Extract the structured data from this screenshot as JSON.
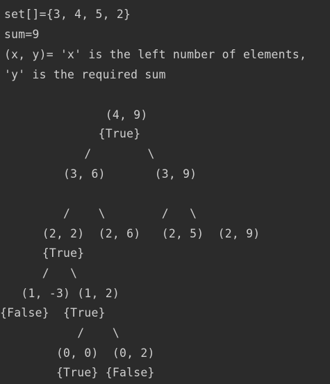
{
  "lines": [
    "set[]={3, 4, 5, 2}",
    "sum=9",
    "(x, y)= 'x' is the left number of elements,",
    "'y' is the required sum",
    "",
    "               (4, 9)",
    "              {True}",
    "            /        \\",
    "         (3, 6)       (3, 9)",
    "",
    "         /    \\        /   \\",
    "      (2, 2)  (2, 6)   (2, 5)  (2, 9)",
    "      {True}",
    "      /   \\",
    "   (1, -3) (1, 2)",
    "{False}  {True}",
    "           /    \\",
    "        (0, 0)  (0, 2)",
    "        {True} {False}"
  ]
}
